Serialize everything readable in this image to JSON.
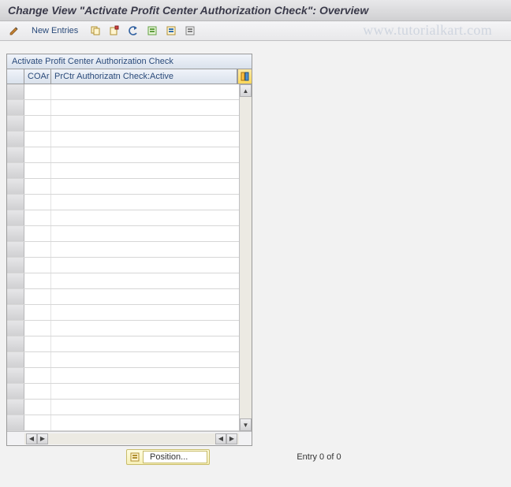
{
  "title": "Change View \"Activate Profit Center Authorization Check\": Overview",
  "toolbar": {
    "new_entries_label": "New Entries"
  },
  "watermark": "www.tutorialkart.com",
  "panel": {
    "header": "Activate Profit Center Authorization Check",
    "columns": {
      "coar": "COAr",
      "prctr_check": "PrCtr Authorizatn Check:Active"
    }
  },
  "footer": {
    "position_label": "Position...",
    "entry_text": "Entry 0 of 0"
  },
  "row_count": 22
}
